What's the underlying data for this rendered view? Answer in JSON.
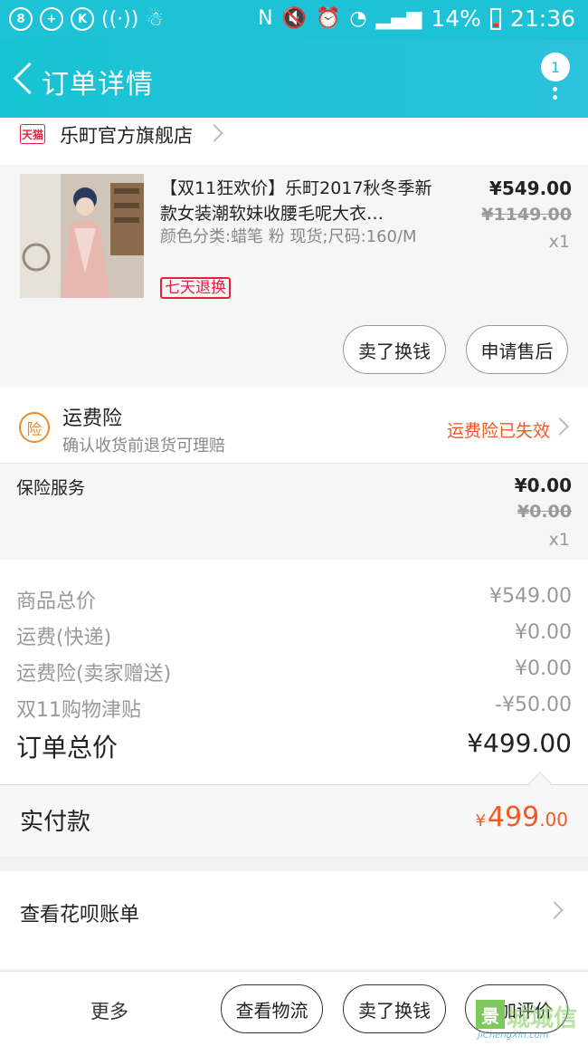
{
  "status_bar": {
    "left_icons": [
      "8",
      "+",
      "K",
      "((·))"
    ],
    "signal_text": "N",
    "battery": "14%",
    "time": "21:36"
  },
  "header": {
    "title": "订单详情",
    "notification_count": "1"
  },
  "store": {
    "badge": "天猫",
    "name": "乐町官方旗舰店"
  },
  "product": {
    "title": "【双11狂欢价】乐町2017秋冬季新款女装潮软妹收腰毛呢大衣…",
    "spec": "颜色分类:蜡笔 粉 现货;尺码:160/M",
    "return_badge": "七天退换",
    "price": "¥549.00",
    "original_price": "¥1149.00",
    "quantity": "x1",
    "buttons": [
      "卖了换钱",
      "申请售后"
    ]
  },
  "insurance": {
    "icon_text": "险",
    "title": "运费险",
    "subtitle": "确认收货前退货可理赔",
    "status": "运费险已失效"
  },
  "service": {
    "label": "保险服务",
    "price": "¥0.00",
    "original_price": "¥0.00",
    "quantity": "x1"
  },
  "summary": {
    "rows": [
      {
        "label": "商品总价",
        "value": "¥549.00"
      },
      {
        "label": "运费(快递)",
        "value": "¥0.00"
      },
      {
        "label": "运费险(卖家赠送)",
        "value": "¥0.00"
      },
      {
        "label": "双11购物津贴",
        "value": "-¥50.00"
      }
    ],
    "total_label": "订单总价",
    "total_value": "¥499.00"
  },
  "paid": {
    "label": "实付款",
    "currency": "¥",
    "amount_int": "499",
    "amount_dec": ".00"
  },
  "huabei": {
    "label": "查看花呗账单"
  },
  "bottom_bar": {
    "more": "更多",
    "buttons": [
      "查看物流",
      "卖了换钱",
      "追加评价"
    ]
  },
  "watermark": {
    "glyph": "景",
    "text": "城城信",
    "url": "JiChengXin.com"
  },
  "colors": {
    "header": "#1ec2d6",
    "accent_orange": "#f05a24",
    "tmall_red": "#e8203e"
  }
}
